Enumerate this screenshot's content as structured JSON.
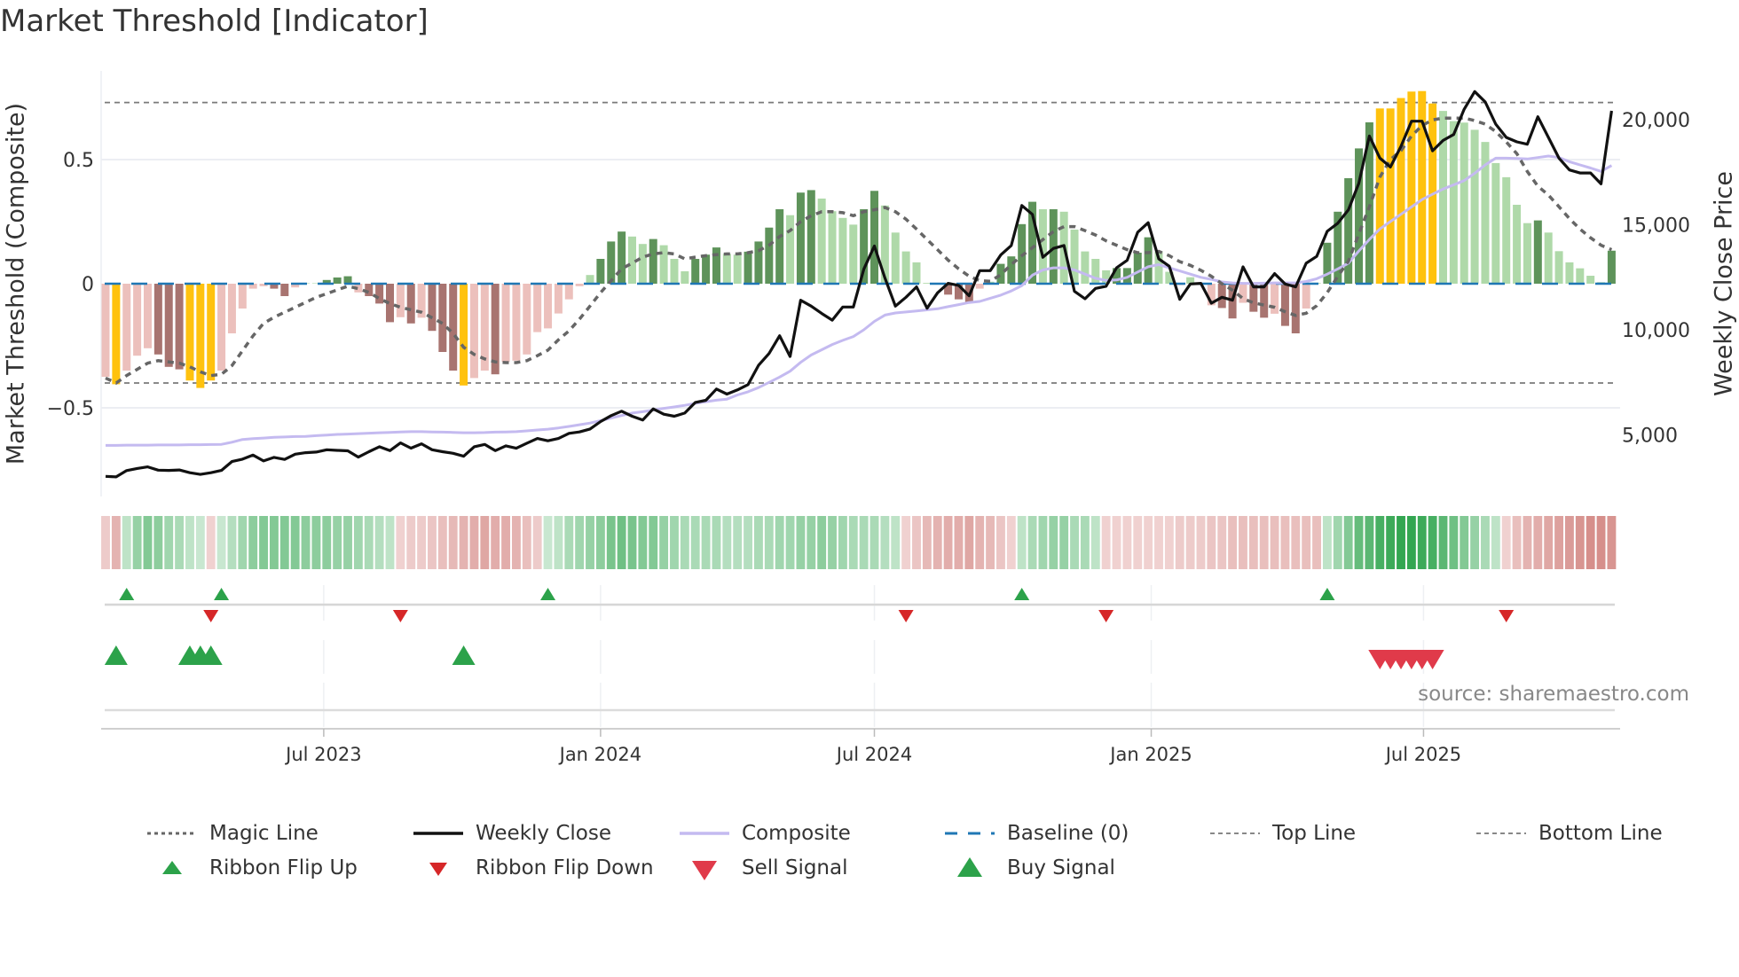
{
  "title": "Market Threshold [Indicator]",
  "source": "source: sharemaestro.com",
  "colors": {
    "bar_light_red": "#ecc0bc",
    "bar_dark_red": "#a87470",
    "bar_yellow": "#ffc20e",
    "bar_light_green": "#afd9a9",
    "bar_dark_green": "#5e935a",
    "magic": "#666666",
    "close": "#111111",
    "composite": "#c4baf0",
    "baseline": "#1f77b4",
    "threshold": "#7a7a7a",
    "flip_up": "#2ca24a",
    "flip_down": "#d62728",
    "buy": "#2ca24a",
    "sell": "#e03a4a"
  },
  "chart_data": {
    "type": "bar",
    "title": "Market Threshold [Indicator]",
    "ylabel": "Market Threshold (Composite)",
    "ylabel_right": "Weekly Close Price",
    "ylim": [
      -0.86,
      0.86
    ],
    "ylim_right": [
      1150,
      22790
    ],
    "yticks": [
      {
        "value": 0.5,
        "label": "0.5"
      },
      {
        "value": 0,
        "label": "0"
      },
      {
        "value": -0.5,
        "label": "−0.5"
      }
    ],
    "yticks_right": [
      {
        "value": 20000,
        "label": "20,000"
      },
      {
        "value": 15000,
        "label": "15,000"
      },
      {
        "value": 10000,
        "label": "10,000"
      },
      {
        "value": 5000,
        "label": "5,000"
      }
    ],
    "xticks": [
      {
        "date": "2023-07-01",
        "label": "Jul 2023"
      },
      {
        "date": "2024-01-01",
        "label": "Jan 2024"
      },
      {
        "date": "2024-07-01",
        "label": "Jul 2024"
      },
      {
        "date": "2025-01-01",
        "label": "Jan 2025"
      },
      {
        "date": "2025-07-01",
        "label": "Jul 2025"
      }
    ],
    "start_date": "2023-02-06",
    "frequency": "weekly",
    "top_line": 0.73,
    "bottom_line": -0.4,
    "baseline": 0,
    "composite_bars": [
      -0.375,
      -0.405,
      -0.35,
      -0.29,
      -0.26,
      -0.285,
      -0.335,
      -0.345,
      -0.39,
      -0.42,
      -0.39,
      -0.35,
      -0.2,
      -0.1,
      -0.02,
      -0.01,
      -0.02,
      -0.05,
      -0.015,
      0.002,
      0.002,
      0.015,
      0.025,
      0.03,
      -0.035,
      -0.05,
      -0.08,
      -0.155,
      -0.135,
      -0.16,
      -0.137,
      -0.19,
      -0.275,
      -0.35,
      -0.41,
      -0.38,
      -0.35,
      -0.365,
      -0.315,
      -0.31,
      -0.285,
      -0.195,
      -0.18,
      -0.12,
      -0.063,
      -0.01,
      0.035,
      0.1,
      0.17,
      0.21,
      0.19,
      0.16,
      0.18,
      0.155,
      0.1,
      0.05,
      0.1,
      0.117,
      0.146,
      0.12,
      0.117,
      0.129,
      0.17,
      0.226,
      0.3,
      0.276,
      0.367,
      0.377,
      0.343,
      0.292,
      0.265,
      0.238,
      0.3,
      0.374,
      0.315,
      0.206,
      0.13,
      0.086,
      0.003,
      0.003,
      -0.044,
      -0.063,
      -0.077,
      -0.02,
      0.008,
      0.08,
      0.11,
      0.24,
      0.33,
      0.3,
      0.3,
      0.29,
      0.218,
      0.13,
      0.1,
      0.054,
      0.063,
      0.063,
      0.125,
      0.187,
      0.13,
      0.048,
      -0.006,
      0.026,
      0.003,
      -0.087,
      -0.098,
      -0.14,
      -0.077,
      -0.113,
      -0.137,
      -0.121,
      -0.17,
      -0.2,
      -0.1,
      0.003,
      0.165,
      0.29,
      0.425,
      0.545,
      0.65,
      0.706,
      0.706,
      0.748,
      0.774,
      0.776,
      0.726,
      0.696,
      0.655,
      0.649,
      0.62,
      0.571,
      0.486,
      0.429,
      0.318,
      0.244,
      0.255,
      0.206,
      0.131,
      0.086,
      0.062,
      0.032,
      0.006,
      0.133
    ],
    "bar_class": [
      "lr",
      "y",
      "lr",
      "lr",
      "lr",
      "dr",
      "dr",
      "dr",
      "y",
      "y",
      "y",
      "lr",
      "lr",
      "lr",
      "lr",
      "lr",
      "dr",
      "dr",
      "lr",
      "lg",
      "lg",
      "dg",
      "dg",
      "dg",
      "lr",
      "dr",
      "dr",
      "dr",
      "lr",
      "dr",
      "lr",
      "dr",
      "dr",
      "dr",
      "y",
      "lr",
      "lr",
      "dr",
      "lr",
      "lr",
      "lr",
      "lr",
      "lr",
      "lr",
      "lr",
      "lr",
      "lg",
      "dg",
      "dg",
      "dg",
      "lg",
      "lg",
      "dg",
      "lg",
      "lg",
      "lg",
      "dg",
      "dg",
      "dg",
      "lg",
      "lg",
      "dg",
      "dg",
      "dg",
      "dg",
      "lg",
      "dg",
      "dg",
      "lg",
      "lg",
      "lg",
      "lg",
      "dg",
      "dg",
      "lg",
      "lg",
      "lg",
      "lg",
      "lg",
      "lg",
      "dr",
      "dr",
      "dr",
      "lr",
      "lg",
      "dg",
      "dg",
      "dg",
      "dg",
      "lg",
      "dg",
      "lg",
      "lg",
      "lg",
      "lg",
      "lg",
      "dg",
      "dg",
      "dg",
      "dg",
      "lg",
      "lg",
      "lr",
      "lg",
      "lg",
      "lr",
      "dr",
      "dr",
      "lr",
      "dr",
      "dr",
      "lr",
      "dr",
      "dr",
      "lr",
      "lg",
      "dg",
      "dg",
      "dg",
      "dg",
      "dg",
      "y",
      "y",
      "y",
      "y",
      "y",
      "y",
      "lg",
      "lg",
      "lg",
      "lg",
      "lg",
      "lg",
      "lg",
      "lg",
      "lg",
      "dg",
      "lg",
      "lg",
      "lg",
      "lg",
      "lg",
      "lg",
      "dg"
    ],
    "magic_line": [
      -0.38,
      -0.4,
      -0.37,
      -0.345,
      -0.32,
      -0.31,
      -0.315,
      -0.32,
      -0.335,
      -0.355,
      -0.37,
      -0.365,
      -0.33,
      -0.27,
      -0.21,
      -0.16,
      -0.135,
      -0.115,
      -0.095,
      -0.075,
      -0.055,
      -0.04,
      -0.025,
      -0.01,
      -0.02,
      -0.035,
      -0.06,
      -0.08,
      -0.095,
      -0.105,
      -0.115,
      -0.137,
      -0.16,
      -0.2,
      -0.256,
      -0.285,
      -0.303,
      -0.315,
      -0.318,
      -0.318,
      -0.31,
      -0.29,
      -0.268,
      -0.226,
      -0.19,
      -0.143,
      -0.09,
      -0.036,
      0.012,
      0.06,
      0.083,
      0.107,
      0.12,
      0.125,
      0.12,
      0.1,
      0.107,
      0.113,
      0.117,
      0.12,
      0.12,
      0.125,
      0.133,
      0.155,
      0.19,
      0.214,
      0.25,
      0.274,
      0.29,
      0.29,
      0.286,
      0.274,
      0.29,
      0.298,
      0.307,
      0.29,
      0.26,
      0.22,
      0.178,
      0.137,
      0.095,
      0.06,
      0.03,
      0.012,
      0.01,
      0.036,
      0.077,
      0.113,
      0.145,
      0.178,
      0.21,
      0.23,
      0.23,
      0.214,
      0.196,
      0.173,
      0.155,
      0.137,
      0.125,
      0.125,
      0.13,
      0.113,
      0.089,
      0.074,
      0.054,
      0.03,
      0.0,
      -0.026,
      -0.06,
      -0.077,
      -0.086,
      -0.095,
      -0.113,
      -0.128,
      -0.119,
      -0.089,
      -0.036,
      0.03,
      0.09,
      0.2,
      0.31,
      0.43,
      0.5,
      0.536,
      0.595,
      0.637,
      0.66,
      0.667,
      0.667,
      0.667,
      0.657,
      0.643,
      0.613,
      0.571,
      0.524,
      0.452,
      0.393,
      0.357,
      0.31,
      0.262,
      0.22,
      0.185,
      0.155,
      0.137
    ],
    "weekly_close": [
      3025,
      3000,
      3300,
      3400,
      3475,
      3320,
      3310,
      3330,
      3200,
      3120,
      3200,
      3306,
      3730,
      3843,
      4040,
      3760,
      3930,
      3830,
      4080,
      4150,
      4180,
      4290,
      4260,
      4240,
      3940,
      4200,
      4435,
      4250,
      4617,
      4365,
      4575,
      4290,
      4200,
      4124,
      3983,
      4435,
      4546,
      4250,
      4477,
      4364,
      4605,
      4829,
      4716,
      4829,
      5070,
      5138,
      5280,
      5632,
      5914,
      6126,
      5886,
      5704,
      6237,
      5983,
      5886,
      6040,
      6546,
      6646,
      7183,
      6942,
      7140,
      7394,
      8307,
      8872,
      9718,
      8730,
      11408,
      11125,
      10775,
      10462,
      11083,
      11083,
      12887,
      13986,
      12465,
      11125,
      11548,
      12042,
      11027,
      11760,
      12211,
      12113,
      11620,
      12816,
      12816,
      13563,
      14014,
      15914,
      15492,
      13450,
      13873,
      14014,
      11830,
      11478,
      11970,
      12070,
      12955,
      13310,
      14646,
      15098,
      13380,
      13027,
      11450,
      12182,
      12211,
      11267,
      11548,
      11408,
      12997,
      12042,
      12042,
      12676,
      12182,
      12042,
      13169,
      13492,
      14688,
      15070,
      15703,
      16970,
      19225,
      18170,
      17747,
      18732,
      19930,
      19930,
      18521,
      19014,
      19296,
      20493,
      21338,
      20845,
      19789,
      19155,
      18944,
      18830,
      20141,
      19155,
      18170,
      17606,
      17465,
      17465,
      16944,
      20423
    ],
    "composite_line": [
      4500,
      4500,
      4510,
      4510,
      4510,
      4520,
      4520,
      4520,
      4530,
      4530,
      4540,
      4550,
      4650,
      4780,
      4820,
      4850,
      4880,
      4900,
      4920,
      4930,
      4960,
      4990,
      5020,
      5040,
      5060,
      5080,
      5100,
      5120,
      5140,
      5150,
      5150,
      5140,
      5130,
      5120,
      5100,
      5100,
      5110,
      5130,
      5140,
      5150,
      5190,
      5230,
      5270,
      5330,
      5400,
      5480,
      5560,
      5680,
      5800,
      5920,
      6040,
      6100,
      6180,
      6260,
      6330,
      6405,
      6500,
      6580,
      6650,
      6700,
      6900,
      7050,
      7250,
      7500,
      7750,
      8030,
      8450,
      8800,
      9050,
      9300,
      9500,
      9680,
      10000,
      10400,
      10700,
      10800,
      10850,
      10900,
      10950,
      11000,
      11100,
      11200,
      11300,
      11350,
      11500,
      11650,
      11850,
      12100,
      12600,
      12850,
      12950,
      12950,
      12850,
      12650,
      12450,
      12350,
      12370,
      12500,
      12750,
      13000,
      13100,
      12950,
      12800,
      12650,
      12500,
      12400,
      12280,
      12230,
      12211,
      12211,
      12220,
      12230,
      12230,
      12230,
      12300,
      12430,
      12650,
      12900,
      13170,
      13750,
      14300,
      14800,
      15150,
      15500,
      15850,
      16200,
      16450,
      16700,
      16900,
      17100,
      17450,
      17850,
      18170,
      18170,
      18150,
      18130,
      18200,
      18270,
      18200,
      18000,
      17850,
      17700,
      17540,
      17820
    ],
    "ribbon": [
      -0.2,
      -0.4,
      0.2,
      0.4,
      0.5,
      0.45,
      0.35,
      0.3,
      0.2,
      0.15,
      -0.15,
      0.15,
      0.25,
      0.35,
      0.45,
      0.5,
      0.5,
      0.5,
      0.5,
      0.45,
      0.45,
      0.45,
      0.4,
      0.4,
      0.35,
      0.3,
      0.25,
      0.2,
      -0.15,
      -0.2,
      -0.2,
      -0.25,
      -0.3,
      -0.35,
      -0.4,
      -0.45,
      -0.5,
      -0.45,
      -0.45,
      -0.4,
      -0.3,
      -0.2,
      0.15,
      0.2,
      0.3,
      0.35,
      0.4,
      0.45,
      0.55,
      0.6,
      0.55,
      0.5,
      0.5,
      0.4,
      0.35,
      0.3,
      0.3,
      0.3,
      0.3,
      0.25,
      0.25,
      0.25,
      0.3,
      0.3,
      0.35,
      0.35,
      0.4,
      0.4,
      0.45,
      0.4,
      0.35,
      0.3,
      0.3,
      0.3,
      0.25,
      0.2,
      -0.15,
      -0.25,
      -0.35,
      -0.4,
      -0.45,
      -0.45,
      -0.5,
      -0.4,
      -0.35,
      -0.25,
      -0.15,
      0.2,
      0.3,
      0.35,
      0.4,
      0.4,
      0.3,
      0.3,
      0.2,
      -0.15,
      -0.15,
      -0.15,
      -0.15,
      -0.15,
      -0.15,
      -0.15,
      -0.2,
      -0.2,
      -0.2,
      -0.25,
      -0.25,
      -0.3,
      -0.3,
      -0.3,
      -0.3,
      -0.3,
      -0.3,
      -0.3,
      -0.3,
      -0.3,
      0.2,
      0.35,
      0.5,
      0.65,
      0.7,
      0.8,
      0.85,
      0.9,
      0.9,
      0.85,
      0.8,
      0.7,
      0.6,
      0.5,
      0.4,
      0.3,
      0.2,
      -0.15,
      -0.3,
      -0.4,
      -0.45,
      -0.5,
      -0.55,
      -0.6,
      -0.65,
      -0.7,
      -0.7,
      -0.65
    ],
    "ribbon_flip_up_weeks": [
      3,
      12,
      43,
      88,
      117
    ],
    "ribbon_flip_down_weeks": [
      11,
      29,
      77,
      96,
      134
    ],
    "buy_signal_weeks": [
      2,
      9,
      10,
      11,
      35
    ],
    "sell_signal_weeks": [
      122,
      123,
      124,
      125,
      126,
      127
    ]
  },
  "legend": [
    {
      "label": "Magic Line",
      "icon": "dotted-line"
    },
    {
      "label": "Weekly Close",
      "icon": "solid-black-line"
    },
    {
      "label": "Composite",
      "icon": "solid-lavender-line"
    },
    {
      "label": "Baseline (0)",
      "icon": "dashed-blue-line"
    },
    {
      "label": "Top Line",
      "icon": "dashed-gray-line"
    },
    {
      "label": "Bottom Line",
      "icon": "dashed-gray-line"
    },
    {
      "label": "Ribbon Flip Up",
      "icon": "triangle-up-green"
    },
    {
      "label": "Ribbon Flip Down",
      "icon": "triangle-down-red"
    },
    {
      "label": "Sell Signal",
      "icon": "triangle-down-red-large"
    },
    {
      "label": "Buy Signal",
      "icon": "triangle-up-green-large"
    }
  ]
}
